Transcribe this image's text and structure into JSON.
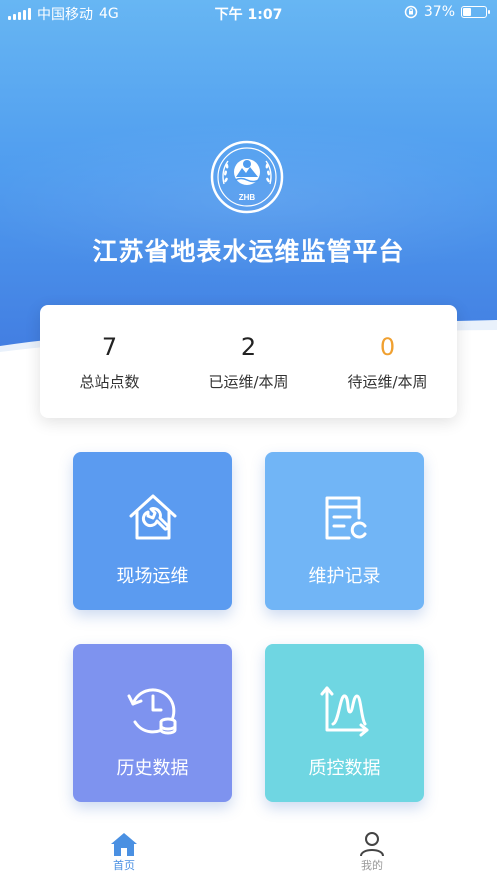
{
  "status_bar": {
    "carrier": "中国移动",
    "network": "4G",
    "time": "下午 1:07",
    "battery_percent": "37%",
    "battery_level": 0.37
  },
  "header": {
    "logo_text": "ZHB",
    "title": "江苏省地表水运维监管平台"
  },
  "stats": [
    {
      "value": "7",
      "label": "总站点数",
      "color": "#222222"
    },
    {
      "value": "2",
      "label": "已运维/本周",
      "color": "#222222"
    },
    {
      "value": "0",
      "label": "待运维/本周",
      "color": "#f0a030"
    }
  ],
  "tiles": [
    {
      "label": "现场运维",
      "icon": "house-wrench-icon",
      "color": "#5b9bf0"
    },
    {
      "label": "维护记录",
      "icon": "record-card-icon",
      "color": "#71b5f6"
    },
    {
      "label": "历史数据",
      "icon": "history-clock-icon",
      "color": "#7e93ef"
    },
    {
      "label": "质控数据",
      "icon": "qc-chart-icon",
      "color": "#6fd6e2"
    }
  ],
  "tabbar": {
    "items": [
      {
        "label": "首页",
        "icon": "home-icon",
        "active": true
      },
      {
        "label": "我的",
        "icon": "user-icon",
        "active": false
      }
    ],
    "active_color": "#4a90e2",
    "inactive_color": "#999999"
  }
}
